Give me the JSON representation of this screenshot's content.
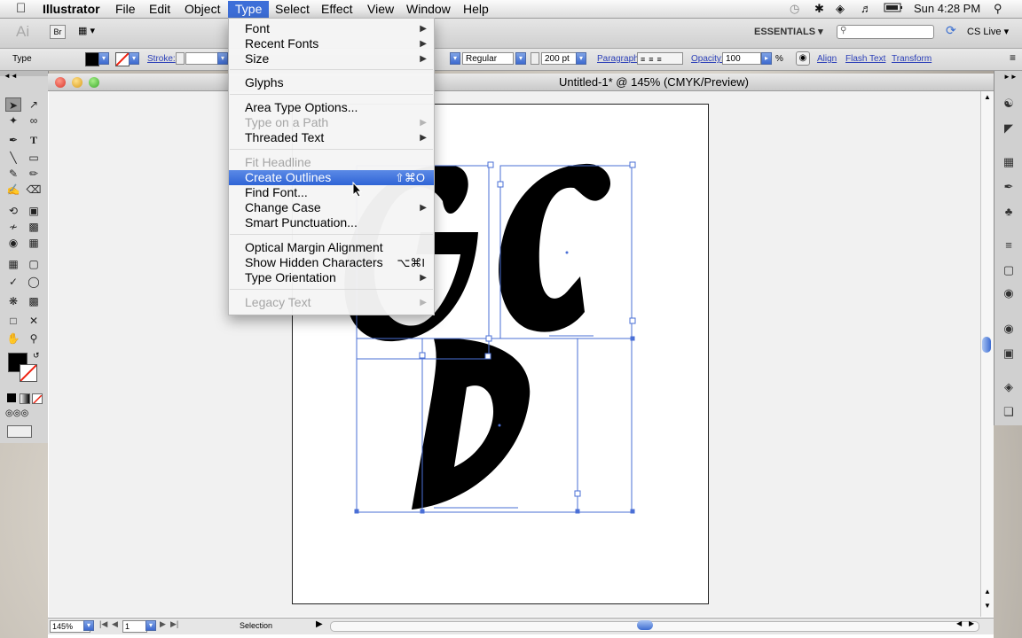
{
  "menubar": {
    "app_name": "Illustrator",
    "items": [
      "File",
      "Edit",
      "Object",
      "Type",
      "Select",
      "Effect",
      "View",
      "Window",
      "Help"
    ],
    "active_item": "Type",
    "clock": "Sun 4:28 PM"
  },
  "appbar": {
    "logo": "Ai",
    "bridge": "Br",
    "workspace": "ESSENTIALS",
    "cs_live": "CS Live"
  },
  "control_bar": {
    "selection_type": "Type",
    "stroke_label": "Stroke:",
    "font_style": "Regular",
    "font_size": "200 pt",
    "paragraph_label": "Paragraph:",
    "opacity_label": "Opacity:",
    "opacity_value": "100",
    "opacity_unit": "%",
    "align_label": "Align",
    "flash_text_label": "Flash Text",
    "transform_label": "Transform"
  },
  "document": {
    "title": "Untitled-1* @ 145% (CMYK/Preview)",
    "zoom": "145%",
    "page": "1",
    "status_tool": "Selection"
  },
  "type_menu": {
    "items": [
      {
        "label": "Font",
        "submenu": true,
        "disabled": false
      },
      {
        "label": "Recent Fonts",
        "submenu": true,
        "disabled": false
      },
      {
        "label": "Size",
        "submenu": true,
        "disabled": false
      },
      {
        "label": "Glyphs",
        "submenu": false,
        "disabled": false
      },
      {
        "label": "Area Type Options...",
        "submenu": false,
        "disabled": false
      },
      {
        "label": "Type on a Path",
        "submenu": true,
        "disabled": true
      },
      {
        "label": "Threaded Text",
        "submenu": true,
        "disabled": false
      },
      {
        "label": "Fit Headline",
        "submenu": false,
        "disabled": true
      },
      {
        "label": "Create Outlines",
        "submenu": false,
        "disabled": false,
        "shortcut": "⇧⌘O",
        "highlighted": true
      },
      {
        "label": "Find Font...",
        "submenu": false,
        "disabled": false
      },
      {
        "label": "Change Case",
        "submenu": true,
        "disabled": false
      },
      {
        "label": "Smart Punctuation...",
        "submenu": false,
        "disabled": false
      },
      {
        "label": "Optical Margin Alignment",
        "submenu": false,
        "disabled": false
      },
      {
        "label": "Show Hidden Characters",
        "submenu": false,
        "disabled": false,
        "shortcut": "⌥⌘I"
      },
      {
        "label": "Type Orientation",
        "submenu": true,
        "disabled": false
      },
      {
        "label": "Legacy Text",
        "submenu": true,
        "disabled": true
      }
    ]
  },
  "canvas": {
    "letters": [
      "G",
      "C",
      "D"
    ]
  },
  "colors": {
    "menu_highlight": "#3d6ed8",
    "selection_bbox": "#4a6fd6",
    "glyph_fill": "#000000"
  }
}
